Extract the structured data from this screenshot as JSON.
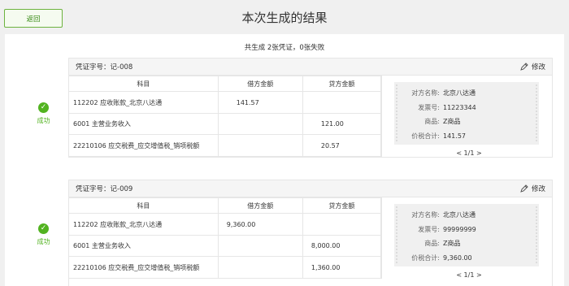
{
  "header": {
    "back_label": "返回",
    "title": "本次生成的结果"
  },
  "summary": "共生成 2张凭证，0张失败",
  "table_headers": {
    "subject": "科目",
    "debit": "借方金额",
    "credit": "贷方金额"
  },
  "edit_label": "修改",
  "invoice_labels": {
    "party": "对方名称:",
    "invoice_no": "发票号:",
    "goods": "商品:",
    "total": "价税合计:"
  },
  "vouchers": [
    {
      "status": "成功",
      "voucher_no": "凭证字号：记-008",
      "rows": [
        {
          "subject": "112202 应收账款_北京八达通",
          "debit": "141.57",
          "credit": ""
        },
        {
          "subject": "6001 主营业务收入",
          "debit": "",
          "credit": "121.00"
        },
        {
          "subject": "22210106 应交税费_应交增值税_销项税额",
          "debit": "",
          "credit": "20.57"
        }
      ],
      "invoice": {
        "party": "北京八达通",
        "invoice_no": "11223344",
        "goods": "Z商品",
        "total": "141.57"
      },
      "pager": "< 1/1 >"
    },
    {
      "status": "成功",
      "voucher_no": "凭证字号：记-009",
      "rows": [
        {
          "subject": "112202 应收账款_北京八达通",
          "debit": "9,360.00",
          "credit": ""
        },
        {
          "subject": "6001 主营业务收入",
          "debit": "",
          "credit": "8,000.00"
        },
        {
          "subject": "22210106 应交税费_应交增值税_销项税额",
          "debit": "",
          "credit": "1,360.00"
        }
      ],
      "invoice": {
        "party": "北京八达通",
        "invoice_no": "99999999",
        "goods": "Z商品",
        "total": "9,360.00"
      },
      "pager": "< 1/1 >"
    }
  ]
}
